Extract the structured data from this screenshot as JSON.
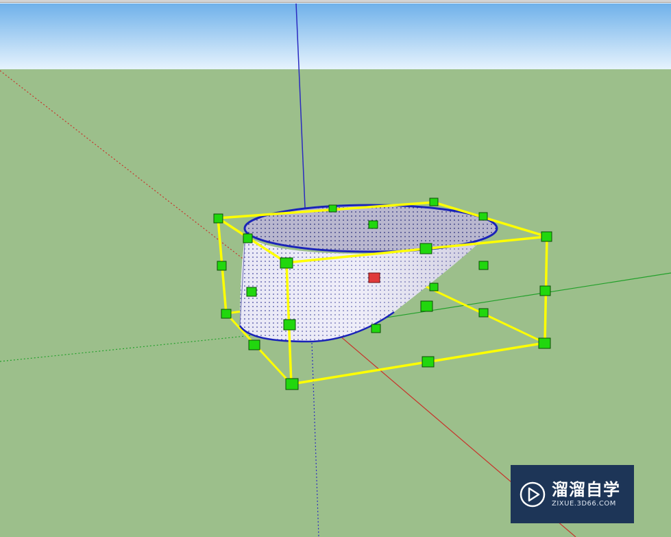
{
  "colors": {
    "sky_top": "#79b8ec",
    "sky_bottom": "#e3f1fc",
    "ground": "#9cbf8b",
    "axis_red": "#c8322a",
    "axis_green": "#22a02a",
    "axis_blue": "#2a2ac0",
    "selection_box": "#ffff00",
    "grip": "#21d70e",
    "center_grip": "#e03a3a",
    "edge_blue": "#1a23b8",
    "watermark_bg": "#1d3557"
  },
  "scene": {
    "selected_object": "cone-like solid",
    "scale_grip_count": 25,
    "tool": "scale"
  },
  "watermark": {
    "title": "溜溜自学",
    "url": "ZIXUE.3D66.COM",
    "icon": "play-icon"
  }
}
